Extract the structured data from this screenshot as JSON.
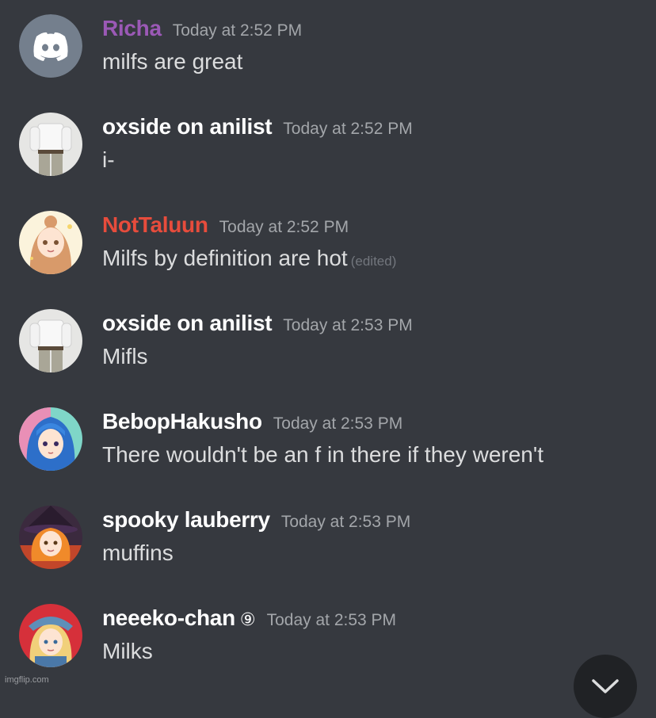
{
  "messages": [
    {
      "username": "Richa",
      "name_color": "#9b59b6",
      "timestamp": "Today at 2:52 PM",
      "text": "milfs are great",
      "avatar": "discord-logo"
    },
    {
      "username": "oxside on anilist",
      "name_color": "#ffffff",
      "timestamp": "Today at 2:52 PM",
      "text": "i-",
      "avatar": "shirt-photo"
    },
    {
      "username": "NotTaluun",
      "name_color": "#e74c3c",
      "timestamp": "Today at 2:52 PM",
      "text": "Milfs by definition are hot",
      "edited": "(edited)",
      "avatar": "anime-girl-pink"
    },
    {
      "username": "oxside on anilist",
      "name_color": "#ffffff",
      "timestamp": "Today at 2:53 PM",
      "text": "Mifls",
      "avatar": "shirt-photo"
    },
    {
      "username": "BebopHakusho",
      "name_color": "#ffffff",
      "timestamp": "Today at 2:53 PM",
      "text": "There wouldn't be an f in there if they weren't",
      "avatar": "anime-girl-blue"
    },
    {
      "username": "spooky lauberry",
      "name_color": "#ffffff",
      "timestamp": "Today at 2:53 PM",
      "text": "muffins",
      "avatar": "anime-witch"
    },
    {
      "username": "neeeko-chan",
      "badge": "⑨",
      "name_color": "#ffffff",
      "timestamp": "Today at 2:53 PM",
      "text": "Milks",
      "avatar": "anime-girl-hat"
    }
  ],
  "watermark": "imgflip.com",
  "colors": {
    "background": "#36393f",
    "timestamp": "#a3a6aa",
    "text": "#dcddde",
    "edited": "#72767d"
  },
  "scroll_button_icon": "chevron-down-icon"
}
